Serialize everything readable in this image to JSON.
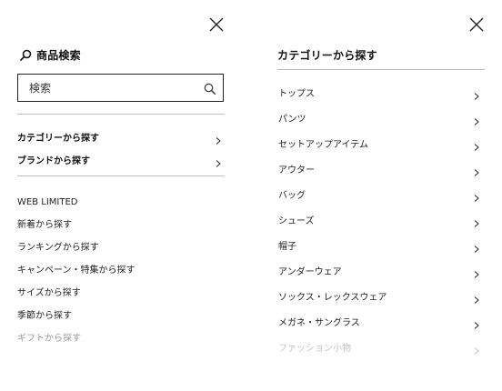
{
  "left_panel": {
    "search_title": "商品検索",
    "search": {
      "placeholder": "検索",
      "value": ""
    },
    "nav_links": [
      {
        "label": "カテゴリーから探す"
      },
      {
        "label": "ブランドから探す"
      }
    ],
    "plain_links": [
      {
        "label": "WEB LIMITED"
      },
      {
        "label": "新着から探す"
      },
      {
        "label": "ランキングから探す"
      },
      {
        "label": "キャンペーン・特集から探す"
      },
      {
        "label": "サイズから探す"
      },
      {
        "label": "季節から探す"
      },
      {
        "label": "ギフトから探す"
      }
    ]
  },
  "right_panel": {
    "title": "カテゴリーから探す",
    "categories": [
      {
        "label": "トップス"
      },
      {
        "label": "パンツ"
      },
      {
        "label": "セットアップアイテム"
      },
      {
        "label": "アウター"
      },
      {
        "label": "バッグ"
      },
      {
        "label": "シューズ"
      },
      {
        "label": "帽子"
      },
      {
        "label": "アンダーウェア"
      },
      {
        "label": "ソックス・レックスウェア"
      },
      {
        "label": "メガネ・サングラス"
      },
      {
        "label": "ファッション小物"
      }
    ]
  },
  "icons": {
    "close": "close-icon",
    "search": "search-icon",
    "chevron": "chevron-right-icon"
  },
  "colors": {
    "text": "#222222",
    "divider": "#bdbdbd",
    "muted": "#9a9a9a",
    "faded": "#c4c4c4"
  }
}
